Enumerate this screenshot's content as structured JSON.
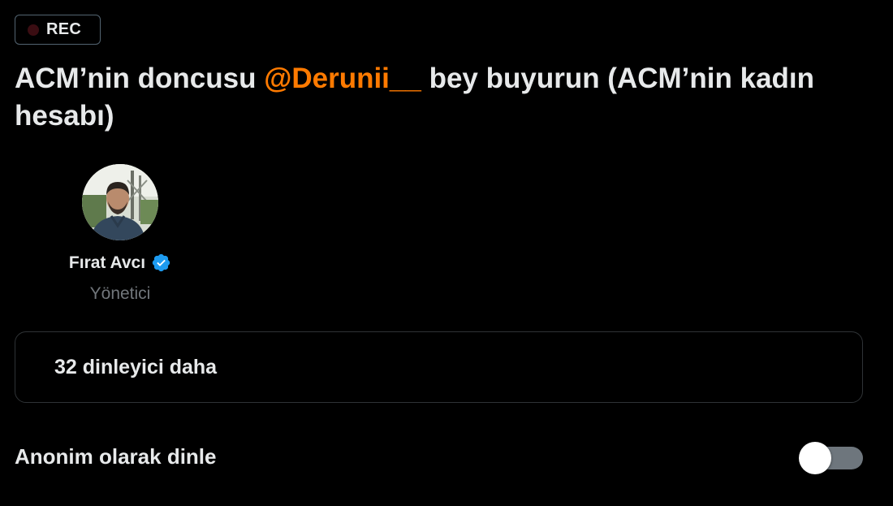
{
  "recording": {
    "badge_label": "REC",
    "dot_color": "#3a0d12"
  },
  "space": {
    "title_before": "ACM’nin doncusu ",
    "title_mention": "@Derunii__",
    "title_after": "  bey buyurun (ACM’nin kadın hesabı)",
    "mention_color": "#ff7a00"
  },
  "host": {
    "name": "Fırat Avcı",
    "role": "Yönetici",
    "avatar_icon": "user-avatar",
    "verified_icon": "verified-badge-icon",
    "verified_color": "#1d9bf0"
  },
  "listeners": {
    "label": "32 dinleyici daha"
  },
  "anonymous": {
    "label": "Anonim olarak dinle",
    "toggle_on": false
  }
}
